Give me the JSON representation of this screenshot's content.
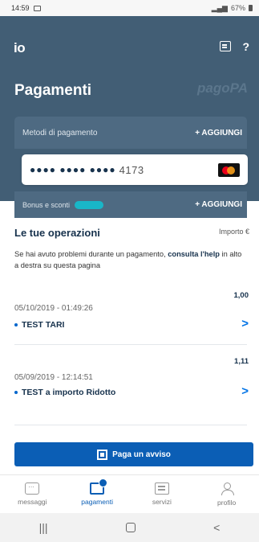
{
  "statusbar": {
    "time": "14:59",
    "battery": "67%"
  },
  "header": {
    "logo": "io",
    "title": "Pagamenti",
    "pagopa_mark": "pagoPA"
  },
  "methods": {
    "label": "Metodi di pagamento",
    "add_label": "+ AGGIUNGI"
  },
  "card": {
    "masked": "●●●● ●●●● ●●●●",
    "last4": "4173",
    "brand_icon": "mastercard-icon"
  },
  "bonus": {
    "label": "Bonus e sconti",
    "add_label": "+ AGGIUNGI"
  },
  "operations": {
    "title": "Le tue operazioni",
    "amount_header": "Importo €",
    "help_before": "Se hai avuto problemi durante un pagamento, ",
    "help_bold": "consulta l'help",
    "help_after": " in alto a destra su questa pagina",
    "items": [
      {
        "amount": "1,00",
        "datetime": "05/10/2019 - 01:49:26",
        "name": "TEST TARI"
      },
      {
        "amount": "1,11",
        "datetime": "05/09/2019 - 12:14:51",
        "name": "TEST a importo Ridotto"
      }
    ]
  },
  "pay_button": {
    "label": "Paga un avviso"
  },
  "tabs": [
    {
      "label": "messaggi",
      "icon": "message-icon"
    },
    {
      "label": "pagamenti",
      "icon": "wallet-icon"
    },
    {
      "label": "servizi",
      "icon": "services-icon"
    },
    {
      "label": "profilo",
      "icon": "profile-icon"
    }
  ],
  "colors": {
    "header_bg": "#425e75",
    "accent": "#0b5eb5"
  }
}
